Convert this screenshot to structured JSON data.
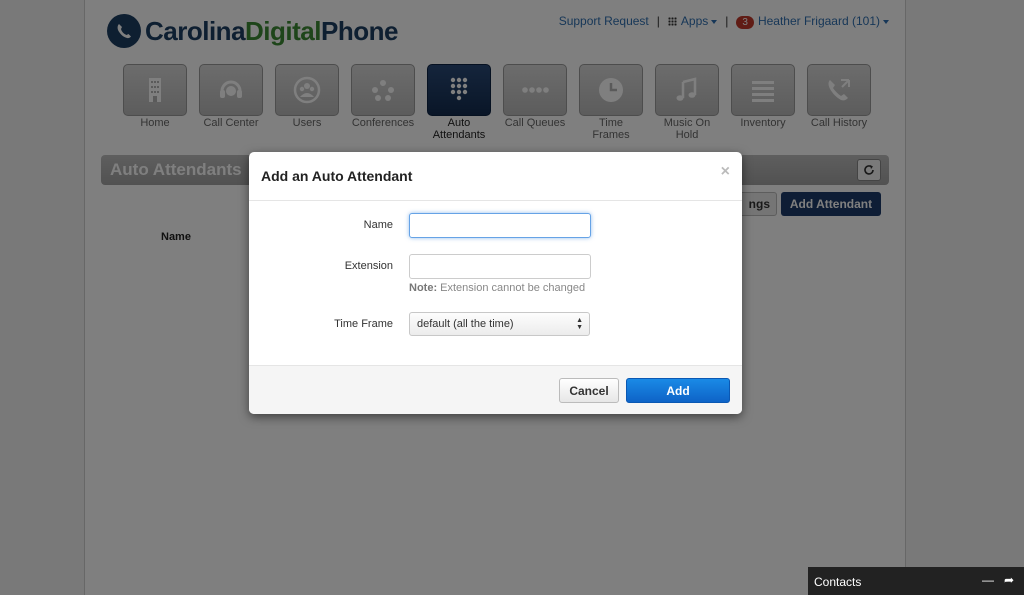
{
  "brand": {
    "part1": "Carolina",
    "part2": "Digital",
    "part3": "Phone"
  },
  "topnav": {
    "support": "Support Request",
    "apps": "Apps",
    "badge_count": "3",
    "user": "Heather Frigaard (101)"
  },
  "tiles": [
    {
      "label": "Home",
      "icon": "building-icon",
      "active": false
    },
    {
      "label": "Call Center",
      "icon": "headset-icon",
      "active": false
    },
    {
      "label": "Users",
      "icon": "users-icon",
      "active": false
    },
    {
      "label": "Conferences",
      "icon": "conference-icon",
      "active": false
    },
    {
      "label": "Auto Attendants",
      "icon": "keypad-icon",
      "active": true
    },
    {
      "label": "Call Queues",
      "icon": "queue-dots-icon",
      "active": false
    },
    {
      "label": "Time Frames",
      "icon": "clock-icon",
      "active": false
    },
    {
      "label": "Music On Hold",
      "icon": "music-note-icon",
      "active": false
    },
    {
      "label": "Inventory",
      "icon": "list-lines-icon",
      "active": false
    },
    {
      "label": "Call History",
      "icon": "phone-history-icon",
      "active": false
    }
  ],
  "section": {
    "title": "Auto Attendants"
  },
  "actions": {
    "settings_partial": "ngs",
    "add_attendant": "Add Attendant"
  },
  "table": {
    "name_header": "Name"
  },
  "modal": {
    "title": "Add an Auto Attendant",
    "close": "×",
    "name_label": "Name",
    "name_value": "",
    "extension_label": "Extension",
    "extension_value": "",
    "note_bold": "Note:",
    "note_text": " Extension cannot be changed",
    "timeframe_label": "Time Frame",
    "timeframe_value": "default (all the time)",
    "cancel": "Cancel",
    "add": "Add"
  },
  "contacts": {
    "label": "Contacts"
  },
  "colors": {
    "primary_navy": "#1c3a6a",
    "add_blue": "#0e63c7",
    "brand_green": "#3d8a35"
  }
}
